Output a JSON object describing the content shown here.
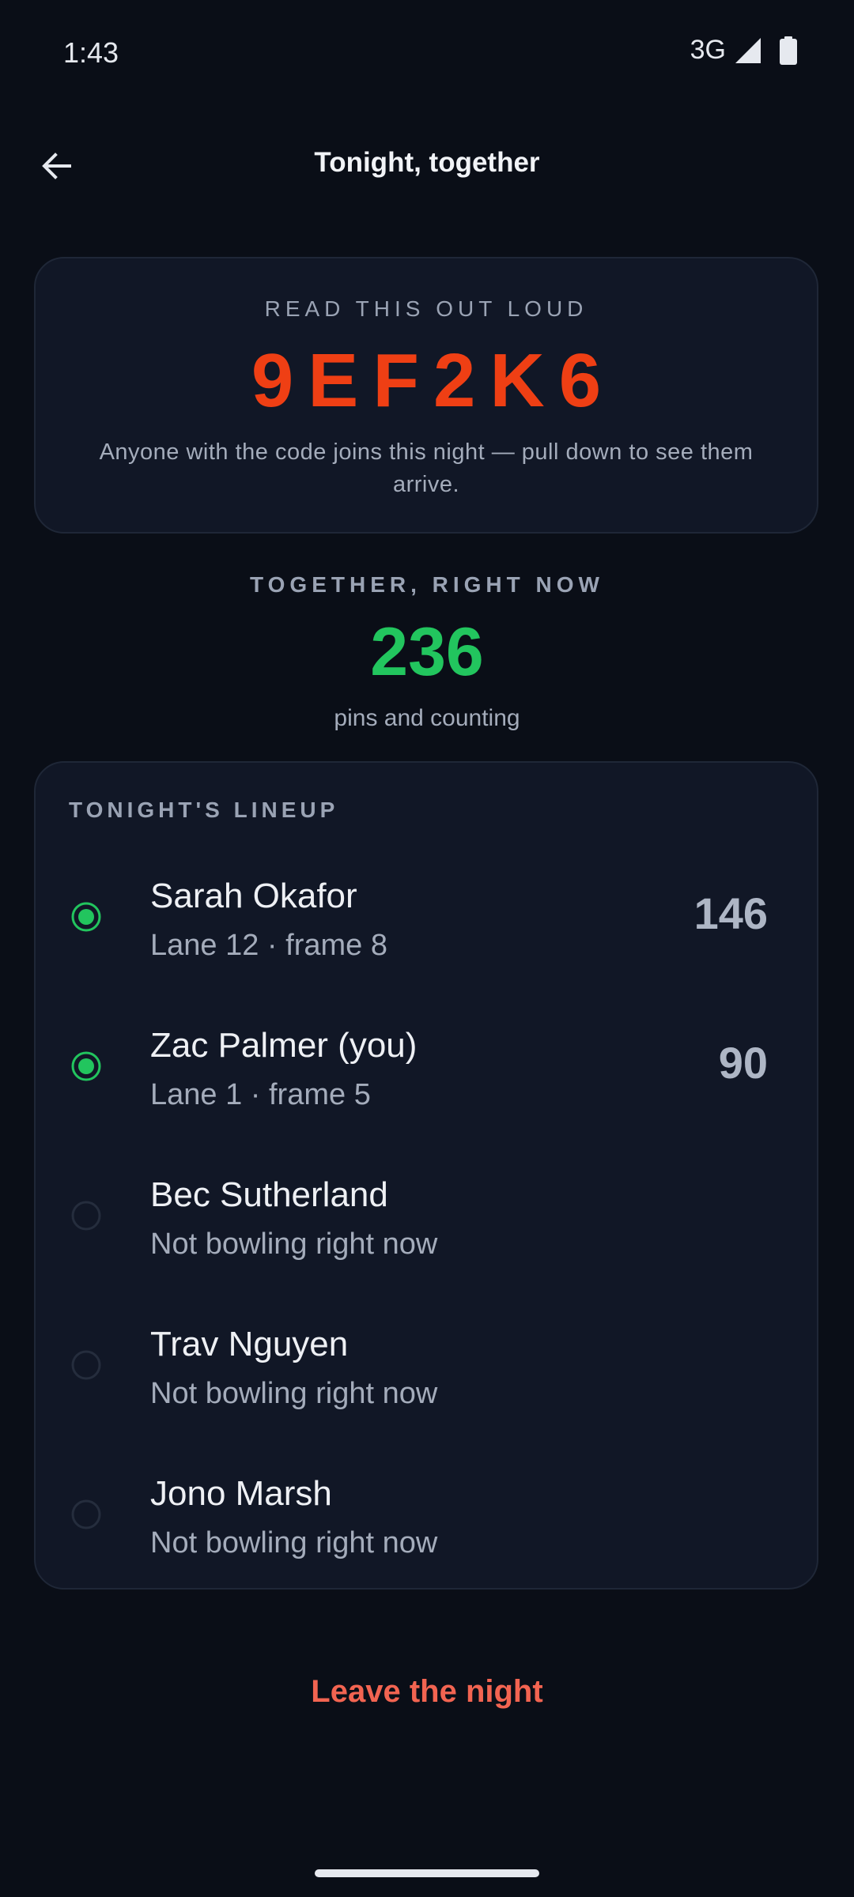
{
  "status_bar": {
    "time": "1:43",
    "network": "3G"
  },
  "header": {
    "title": "Tonight, together"
  },
  "code_card": {
    "eyebrow": "READ THIS OUT LOUD",
    "code": "9EF2K6",
    "help": "Anyone with the code joins this night — pull down to see them arrive."
  },
  "together": {
    "eyebrow": "TOGETHER, RIGHT NOW",
    "count": "236",
    "subtitle": "pins and counting"
  },
  "lineup": {
    "heading": "TONIGHT'S LINEUP",
    "players": [
      {
        "name": "Sarah Okafor",
        "status": "Lane 12 · frame 8",
        "score": "146",
        "active": true
      },
      {
        "name": "Zac Palmer (you)",
        "status": "Lane 1 · frame 5",
        "score": "90",
        "active": true
      },
      {
        "name": "Bec Sutherland",
        "status": "Not bowling right now",
        "score": "",
        "active": false
      },
      {
        "name": "Trav Nguyen",
        "status": "Not bowling right now",
        "score": "",
        "active": false
      },
      {
        "name": "Jono Marsh",
        "status": "Not bowling right now",
        "score": "",
        "active": false
      }
    ]
  },
  "actions": {
    "leave_label": "Leave the night"
  },
  "colors": {
    "background": "#0a0e17",
    "card": "#111726",
    "code_accent": "#ef3f14",
    "count_accent": "#22c55e",
    "active_dot": "#22c55e",
    "leave": "#f26451"
  },
  "icons": {
    "back": "arrow-left-icon",
    "signal": "signal-icon",
    "battery": "battery-icon",
    "active": "presence-active-icon",
    "inactive": "presence-inactive-icon"
  }
}
